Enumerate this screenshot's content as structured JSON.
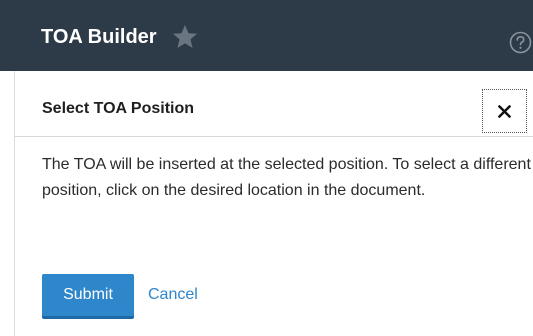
{
  "header": {
    "title": "TOA Builder",
    "favorite_icon": "star-icon",
    "help_icon": "help-icon"
  },
  "dialog": {
    "title": "Select TOA Position",
    "close_icon": "close-icon",
    "message": "The TOA will be inserted at the selected position. To select a different position, click on the desired location in the document.",
    "submit_label": "Submit",
    "cancel_label": "Cancel"
  },
  "colors": {
    "header_background": "#2d3a47",
    "accent": "#2e86cb",
    "star": "#6b7580"
  }
}
